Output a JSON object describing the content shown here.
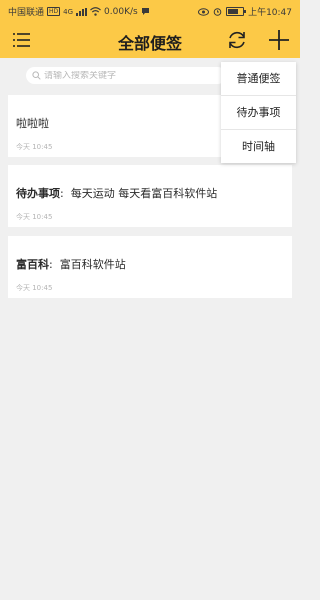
{
  "status_bar": {
    "carrier": "中国联通",
    "hd": "HD",
    "network": "4G",
    "speed": "0.00K/s",
    "time": "上午10:47",
    "battery_level": 0.75
  },
  "header": {
    "title": "全部便签"
  },
  "search": {
    "placeholder": "请输入搜索关键字"
  },
  "notes": [
    {
      "label": "",
      "text": "啦啦啦",
      "time": "今天 10:45"
    },
    {
      "label": "待办事项",
      "text": "每天运动 每天看富百科软件站",
      "time": "今天 10:45"
    },
    {
      "label": "富百科",
      "text": "富百科软件站",
      "time": "今天 10:45"
    }
  ],
  "dropdown": {
    "items": [
      "普通便签",
      "待办事项",
      "时间轴"
    ]
  }
}
